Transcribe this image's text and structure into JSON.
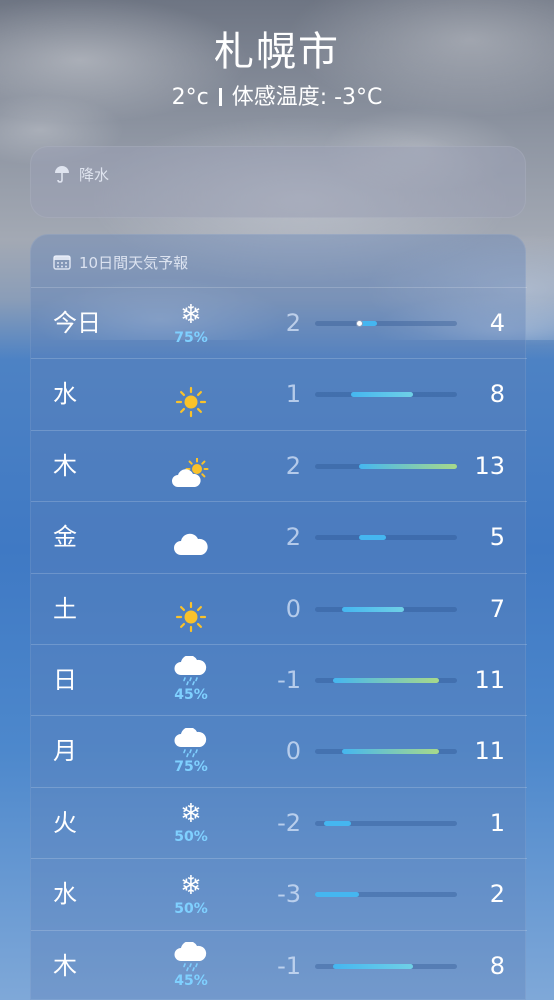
{
  "location": {
    "city": "札幌市",
    "temp": "2°c",
    "feels_like": "体感温度: -3°C"
  },
  "precipitation_card": {
    "title": "降水",
    "icon": "umbrella-icon"
  },
  "forecast_card": {
    "title": "10日間天気予報",
    "icon": "calendar-icon",
    "scale": {
      "min": -3,
      "max": 13
    },
    "current_temp": 2,
    "days": [
      {
        "day": "今日",
        "icon": "snowflake",
        "chance": "75%",
        "low": "2",
        "high": "4",
        "lo": 2,
        "hi": 4
      },
      {
        "day": "水",
        "icon": "sun",
        "chance": "",
        "low": "1",
        "high": "8",
        "lo": 1,
        "hi": 8
      },
      {
        "day": "木",
        "icon": "cloud-sun",
        "chance": "",
        "low": "2",
        "high": "13",
        "lo": 2,
        "hi": 13
      },
      {
        "day": "金",
        "icon": "cloud",
        "chance": "",
        "low": "2",
        "high": "5",
        "lo": 2,
        "hi": 5
      },
      {
        "day": "土",
        "icon": "sun",
        "chance": "",
        "low": "0",
        "high": "7",
        "lo": 0,
        "hi": 7
      },
      {
        "day": "日",
        "icon": "cloud-rain",
        "chance": "45%",
        "low": "-1",
        "high": "11",
        "lo": -1,
        "hi": 11
      },
      {
        "day": "月",
        "icon": "cloud-rain",
        "chance": "75%",
        "low": "0",
        "high": "11",
        "lo": 0,
        "hi": 11
      },
      {
        "day": "火",
        "icon": "snowflake",
        "chance": "50%",
        "low": "-2",
        "high": "1",
        "lo": -2,
        "hi": 1
      },
      {
        "day": "水",
        "icon": "snowflake",
        "chance": "50%",
        "low": "-3",
        "high": "2",
        "lo": -3,
        "hi": 2
      },
      {
        "day": "木",
        "icon": "cloud-rain",
        "chance": "45%",
        "low": "-1",
        "high": "8",
        "lo": -1,
        "hi": 8
      }
    ]
  },
  "colors": {
    "cold": "#45b6f0",
    "mild": "#6fd0e6",
    "warm": "#a7d98a",
    "sun": "#f9c22b",
    "percent": "#7fd0ff"
  }
}
